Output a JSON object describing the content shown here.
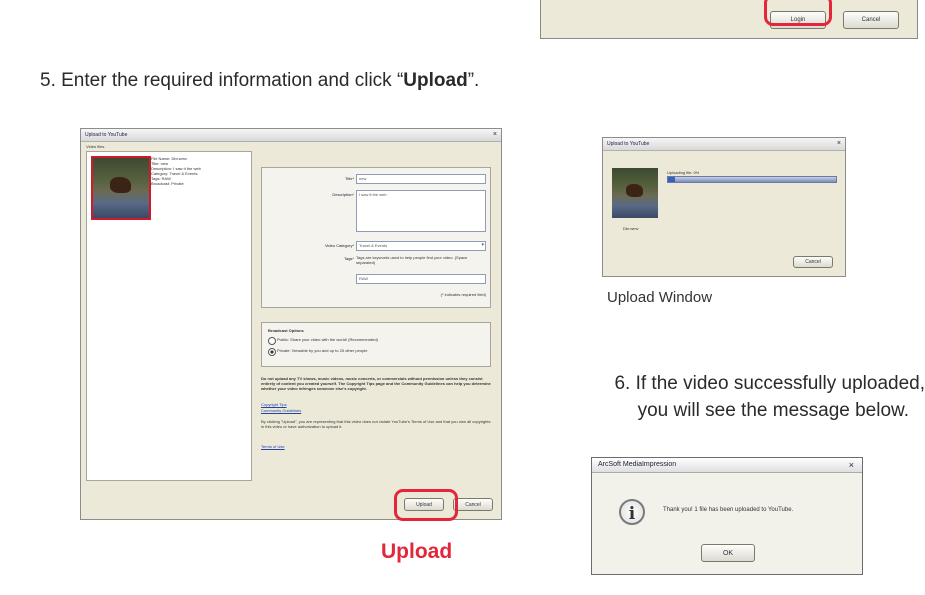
{
  "top_dialog": {
    "login_label": "Login",
    "cancel_label": "Cancel"
  },
  "step5": {
    "prefix": "5. Enter the required information and click “",
    "bold": "Upload",
    "suffix": "”."
  },
  "upload_dialog": {
    "title": "Upload to YouTube",
    "section_label": "Video files",
    "file_info": [
      "File Name: Dbr.wmv",
      "Title: new",
      "Description: I saw it the web",
      "Category: Travel & Events",
      "Tags: RAW",
      "Broadcast: Private"
    ],
    "form": {
      "title_label": "Title*",
      "title_value": "new",
      "description_label": "Description*",
      "description_value": "I saw it the web",
      "category_label": "Video Category*",
      "category_value": "Travel & Events",
      "tags_label": "Tags*",
      "tags_hint": "Tags are keywords used to help people find your video. (Space separated)",
      "tags_value": "RAW",
      "required_note": "(* indicates required field)"
    },
    "broadcast": {
      "heading": "Broadcast Options",
      "public_label": "Public: Share your video with the world! (Recommended)",
      "private_label": "Private: Viewable by you and up to 25 other people"
    },
    "legal_bold": "Do not upload any TV shows, music videos, music concerts, or commercials without permission unless they consist entirely of content you created yourself. The Copyright Tips page and the Community Guidelines can help you determine whether your video infringes someone else's copyright.",
    "link1": "Copyright Tips",
    "link2": "Community Guidelines",
    "legal_text": "By clicking \"Upload\", you are representing that this video does not violate YouTube's Terms of Use and that you own all copyrights in this video or have authorization to upload it.",
    "link3": "Terms of Use",
    "upload_label": "Upload",
    "cancel_label": "Cancel"
  },
  "upload_caption": "Upload",
  "progress_window": {
    "title": "Upload to YouTube",
    "status": "Uploading file: 0%",
    "filename": "Dbr.wmv",
    "cancel_label": "Cancel",
    "progress": 0.04
  },
  "progress_caption": "Upload Window",
  "step6": {
    "line1": "6. If the video successfully uploaded,",
    "line2": "you will see the message below."
  },
  "message_box": {
    "title": "ArcSoft MediaImpression",
    "icon": "info-icon",
    "message": "Thank you! 1 file has been uploaded to YouTube.",
    "ok_label": "OK"
  },
  "colors": {
    "highlight": "#e3263a",
    "caption_red": "#e3263a"
  }
}
